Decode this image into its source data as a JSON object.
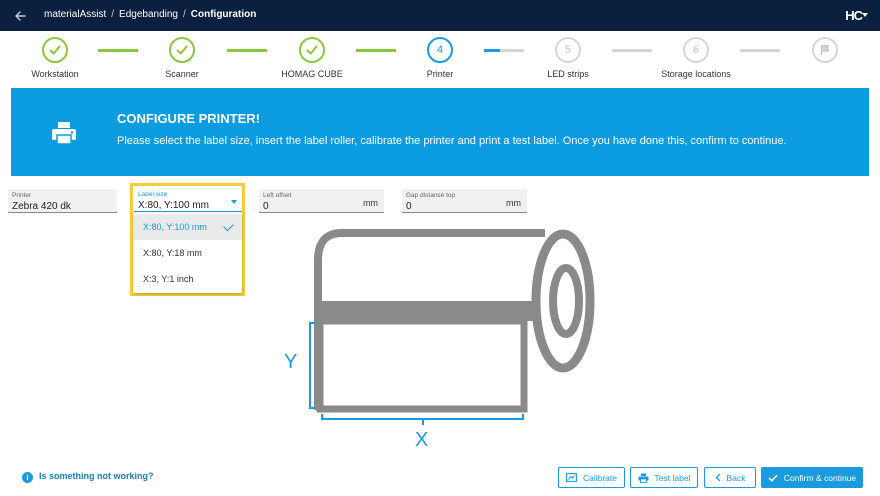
{
  "breadcrumbs": [
    "materialAssist",
    "Edgebanding",
    "Configuration"
  ],
  "brand": {
    "logo_text": "HC"
  },
  "steps": [
    {
      "label": "Workstation",
      "state": "done"
    },
    {
      "label": "Scanner",
      "state": "done"
    },
    {
      "label": "HOMAG CUBE",
      "state": "done"
    },
    {
      "label": "Printer",
      "number": "4",
      "state": "active"
    },
    {
      "label": "LED strips",
      "number": "5",
      "state": "todo"
    },
    {
      "label": "Storage locations",
      "number": "6",
      "state": "todo"
    },
    {
      "label": "",
      "state": "todo",
      "icon": "flag-icon"
    }
  ],
  "banner": {
    "title": "CONFIGURE PRINTER!",
    "text": "Please select the label size, insert the label roller, calibrate the printer and print a test label. Once you have done this, confirm to continue.",
    "icon": "printer-icon"
  },
  "form": {
    "printer": {
      "label": "Printer",
      "value": "Zebra 420 dk"
    },
    "label_size": {
      "label": "Label size",
      "value": "X:80, Y:100 mm",
      "options": [
        "X:80, Y:100 mm",
        "X:80, Y:18 mm",
        "X:3, Y:1 inch"
      ],
      "selected_index": 0
    },
    "left_offset": {
      "label": "Left offset",
      "value": "0",
      "unit": "mm"
    },
    "gap_distance_top": {
      "label": "Gap distance top",
      "value": "0",
      "unit": "mm"
    }
  },
  "illustration": {
    "y_label": "Y",
    "x_label": "X"
  },
  "footer": {
    "help": "Is something not working?",
    "buttons": {
      "calibrate": "Calibrate",
      "test_label": "Test label",
      "back": "Back",
      "confirm": "Confirm & continue"
    }
  },
  "colors": {
    "topbar": "#0b1f3f",
    "accent": "#1a9be0",
    "done": "#8cc63f",
    "highlight": "#f5cd3d",
    "roll": "#8a8a8a"
  }
}
